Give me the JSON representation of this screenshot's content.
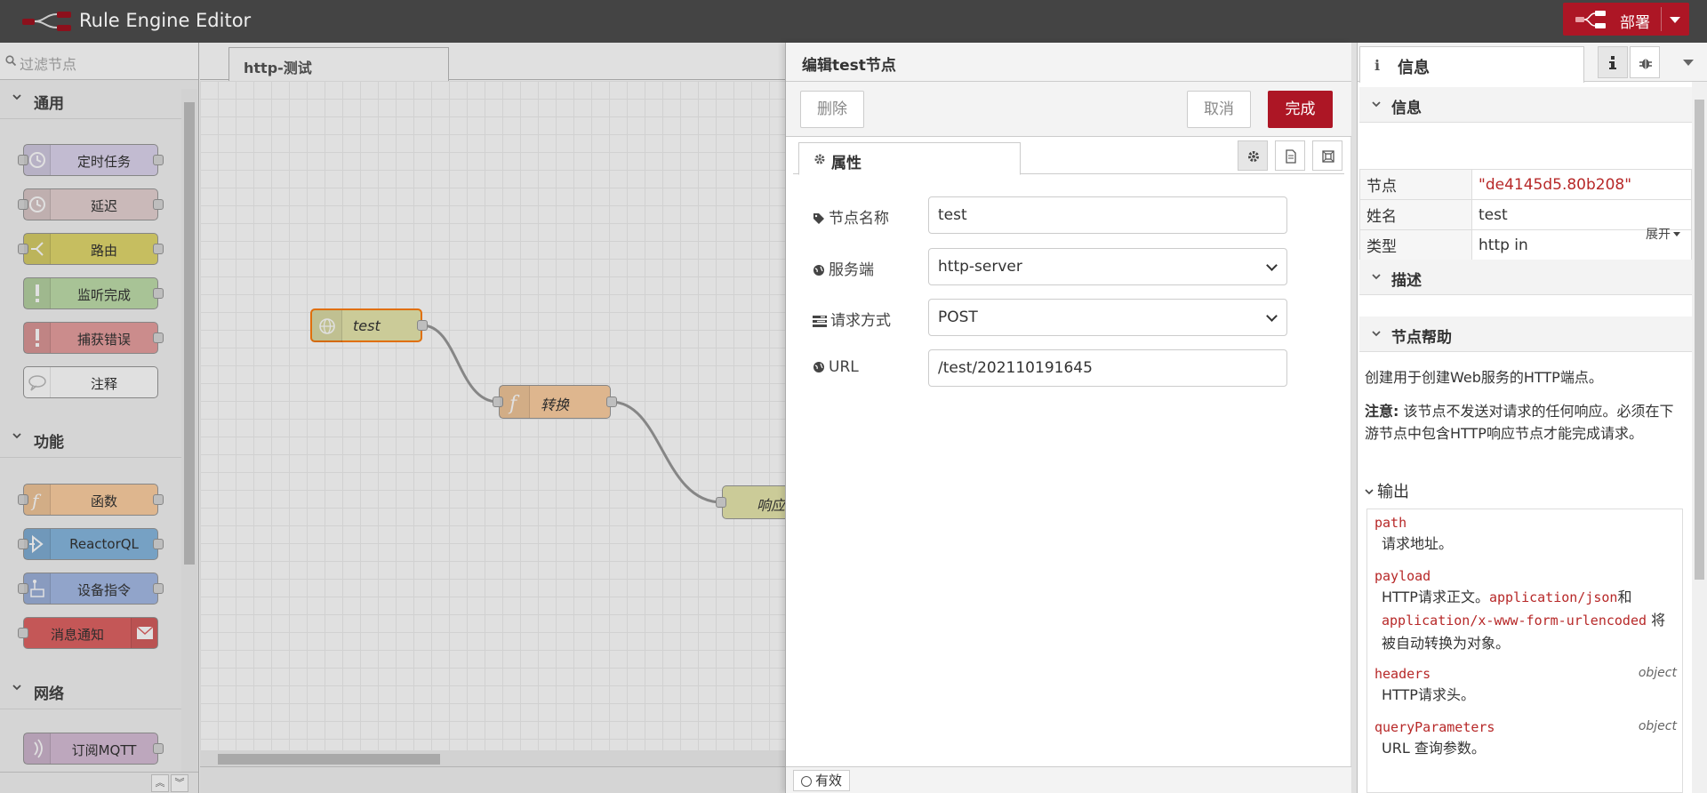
{
  "app": {
    "title": "Rule Engine Editor",
    "deploy_label": "部署"
  },
  "palette": {
    "filter_placeholder": "过滤节点",
    "categories": [
      {
        "label": "通用",
        "nodes": [
          "定时任务",
          "延迟",
          "路由",
          "监听完成",
          "捕获错误",
          "注释"
        ]
      },
      {
        "label": "功能",
        "nodes": [
          "函数",
          "ReactorQL",
          "设备指令",
          "消息通知"
        ]
      },
      {
        "label": "网络",
        "nodes": [
          "订阅MQTT"
        ]
      }
    ]
  },
  "workspace": {
    "tab_label": "http-测试",
    "nodes": [
      {
        "label": "test",
        "color": "#e7e7ae"
      },
      {
        "label": "转换",
        "color": "#fdd0a2"
      },
      {
        "label": "响应",
        "color": "#e7e7ae"
      }
    ]
  },
  "editor": {
    "title": "编辑test节点",
    "delete_label": "删除",
    "cancel_label": "取消",
    "done_label": "完成",
    "tab_label": "属性",
    "fields": {
      "name_label": "节点名称",
      "name_value": "test",
      "server_label": "服务端",
      "server_value": "http-server",
      "method_label": "请求方式",
      "method_value": "POST",
      "url_label": "URL",
      "url_value": "/test/202110191645"
    },
    "status_label": "有效"
  },
  "info": {
    "tab_label": "信息",
    "section_info": "信息",
    "rows": [
      {
        "key": "节点",
        "value": "\"de4145d5.80b208\""
      },
      {
        "key": "姓名",
        "value": "test"
      },
      {
        "key": "类型",
        "value": "http in"
      }
    ],
    "more_label": "展开",
    "section_desc": "描述",
    "section_help": "节点帮助",
    "help_intro": "创建用于创建Web服务的HTTP端点。",
    "note_bold": "注意:",
    "note_text": " 该节点不发送对请求的任何响应。必须在下游节点中包含HTTP响应节点才能完成请求。",
    "outputs_label": "输出",
    "outputs": [
      {
        "name": "path",
        "type": "",
        "desc": "请求地址。"
      },
      {
        "name": "payload",
        "type": "",
        "desc_pre": "HTTP请求正文。",
        "code1": "application/json",
        "mid": "和",
        "code2": "application/x-www-form-urlencoded",
        "desc_post": "将被自动转换为对象。"
      },
      {
        "name": "headers",
        "type": "object",
        "desc": "HTTP请求头。"
      },
      {
        "name": "queryParameters",
        "type": "object",
        "desc": "URL 查询参数。"
      }
    ]
  },
  "colors": {
    "accent": "#ad1625",
    "header": "#444444",
    "string_red": "#b72828"
  }
}
